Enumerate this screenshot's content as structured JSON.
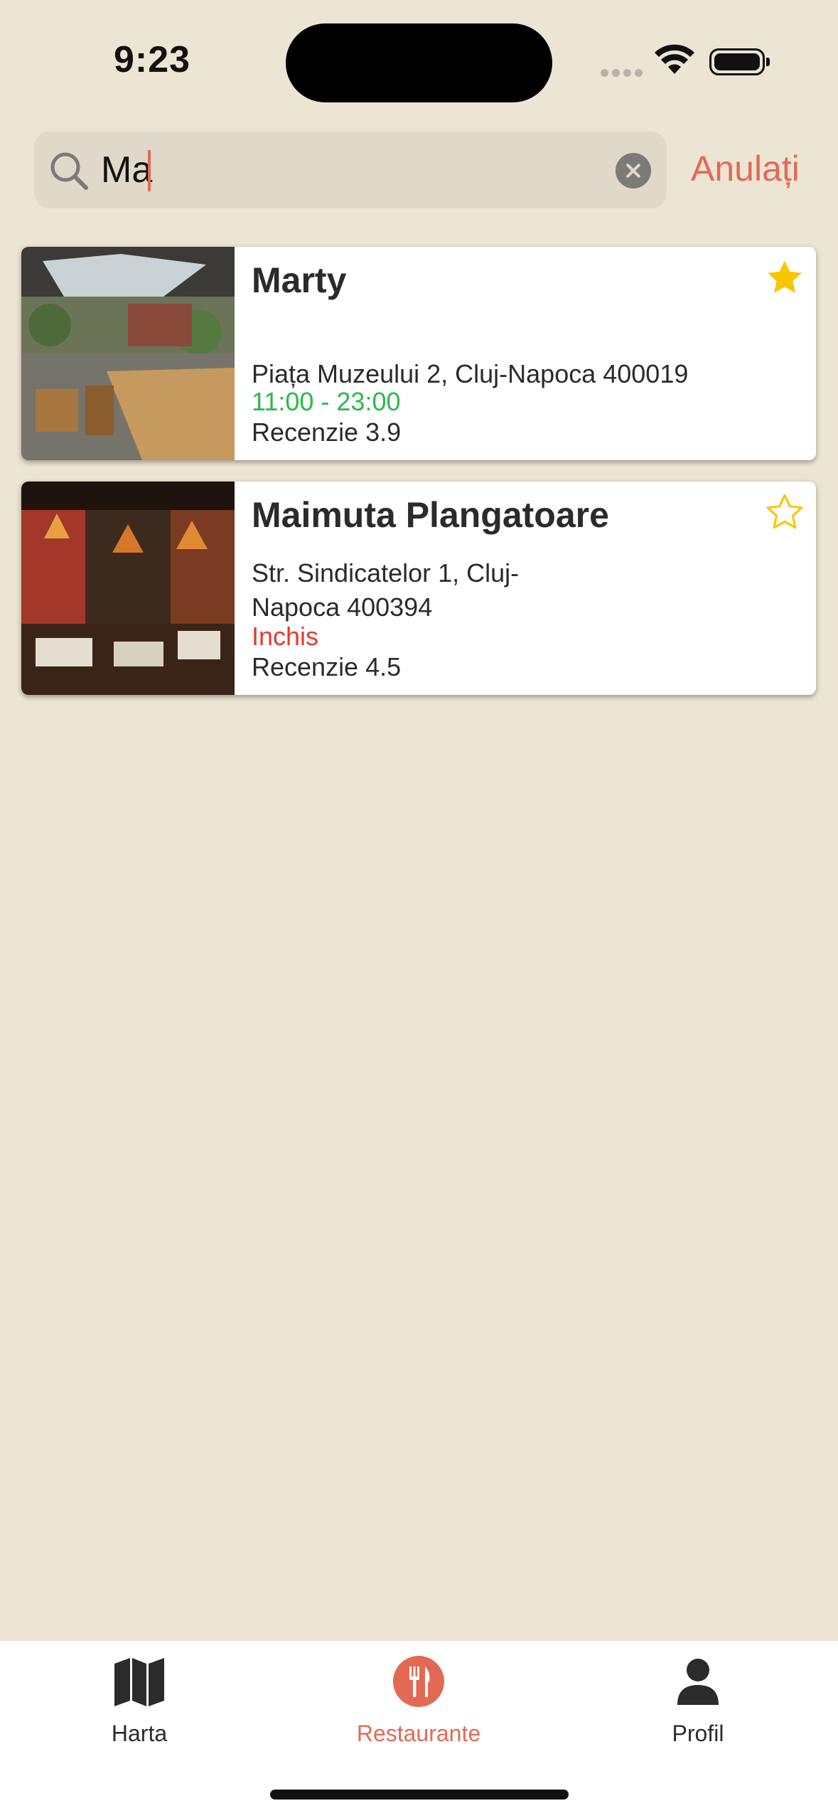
{
  "status_bar": {
    "time": "9:23"
  },
  "search": {
    "value": "Ma",
    "cancel_label": "Anulați"
  },
  "colors": {
    "accent": "#E26A55",
    "open": "#2DB84C",
    "closed": "#E53A2E",
    "favorite": "#F7C600",
    "background": "#EDE5D4"
  },
  "restaurants": [
    {
      "name": "Marty",
      "address": "Piața Muzeului 2, Cluj-Napoca 400019",
      "hours": "11:00 - 23:00",
      "hours_status": "open",
      "rating": "Recenzie 3.9",
      "favorite": true
    },
    {
      "name": "Maimuta Plangatoare",
      "address": "Str. Sindicatelor 1, Cluj-Napoca 400394",
      "hours": "Inchis",
      "hours_status": "closed",
      "rating": "Recenzie 4.5",
      "favorite": false
    }
  ],
  "tabs": [
    {
      "label": "Harta",
      "icon": "map-icon",
      "active": false
    },
    {
      "label": "Restaurante",
      "icon": "fork-knife-icon",
      "active": true
    },
    {
      "label": "Profil",
      "icon": "person-icon",
      "active": false
    }
  ]
}
